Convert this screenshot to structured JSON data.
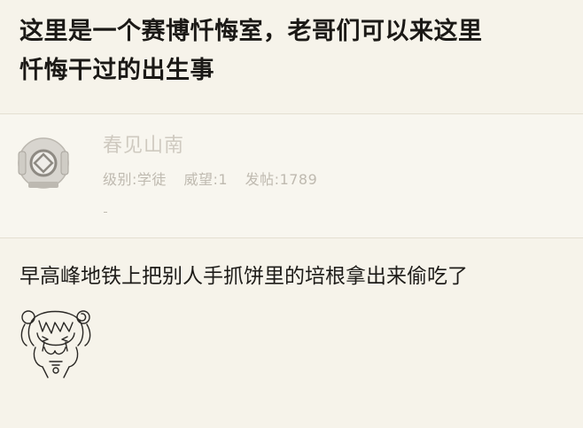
{
  "post": {
    "title_line1": "这里是一个赛博忏悔室，老哥们可以来这里",
    "title_line2": "忏悔干过的出生事"
  },
  "author": {
    "name": "春见山南",
    "level_label": "级别:学徒",
    "prestige_label": "威望:1",
    "posts_label": "发帖:1789"
  },
  "comment": {
    "text": "早高峰地铁上把别人手抓饼里的培根拿出来偷吃了"
  },
  "icons": {
    "avatar": "diving-helmet-icon",
    "sticker": "crying-anime-girl-sticker"
  },
  "colors": {
    "background": "#f6f3ea",
    "muted_text": "#c6c1b7",
    "body_text": "#1e1c19"
  }
}
